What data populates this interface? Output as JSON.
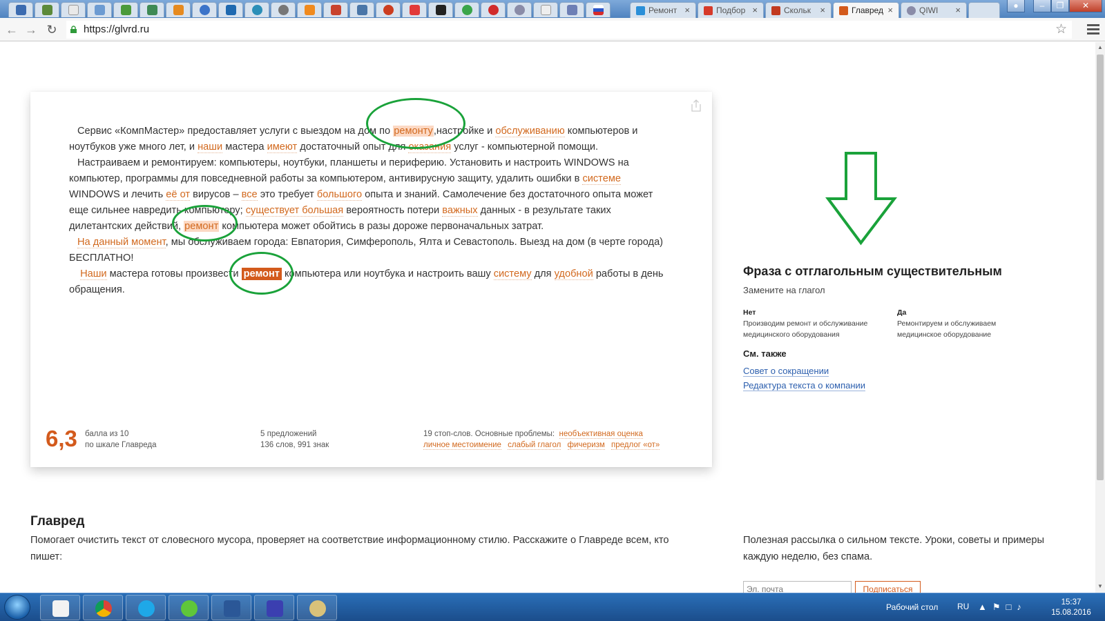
{
  "browser": {
    "tabs": [
      {
        "label": "Ремонт",
        "active": false
      },
      {
        "label": "Подбор",
        "active": false
      },
      {
        "label": "Скольк",
        "active": false
      },
      {
        "label": "Главред",
        "active": true
      },
      {
        "label": "QIWI",
        "active": false
      }
    ],
    "url": "https://glvrd.ru",
    "close_glyph": "×"
  },
  "editor": {
    "score": "6,3",
    "score_line1": "балла из 10",
    "score_line2": "по шкале Главреда",
    "stats_line1": "5 предложений",
    "stats_line2": "136 слов, 991 знак",
    "problems_label": "19 стоп-слов. Основные проблемы:",
    "problems": [
      "необъективная оценка",
      "личное местоимение",
      "слабый глагол",
      "фичеризм",
      "предлог «от»"
    ],
    "paragraphs": [
      [
        {
          "t": "Сервис «КомпМастер» предоставляет услуги с выездом на дом по "
        },
        {
          "t": "ремонту",
          "h": "bg"
        },
        {
          "t": ","
        },
        {
          "t": "настройке и "
        },
        {
          "t": "обслуживанию",
          "h": "u"
        },
        {
          "t": " компьютеров и ноутбуков уже много лет, и "
        },
        {
          "t": "наши",
          "h": "u"
        },
        {
          "t": " мастера "
        },
        {
          "t": "имеют",
          "h": "u"
        },
        {
          "t": " достаточный опыт для "
        },
        {
          "t": "оказания",
          "h": "u"
        },
        {
          "t": " услуг - компьютерной помощи."
        }
      ],
      [
        {
          "t": "Настраиваем и ремонтируем: компьютеры, ноутбуки, планшеты и периферию. Установить и настроить WINDOWS на компьютер, программы для повседневной работы за компьютером, антивирусную защиту, удалить ошибки в "
        },
        {
          "t": "системе",
          "h": "u"
        },
        {
          "t": " WINDOWS и лечить "
        },
        {
          "t": "её от",
          "h": "u"
        },
        {
          "t": " вирусов – "
        },
        {
          "t": "все",
          "h": "u"
        },
        {
          "t": " это требует "
        },
        {
          "t": "большого",
          "h": "u"
        },
        {
          "t": " опыта и знаний. Самолечение без достаточного опыта может еще сильнее навредить компьютеру; "
        },
        {
          "t": "существует большая",
          "h": "u"
        },
        {
          "t": " вероятность потери "
        },
        {
          "t": "важных",
          "h": "u"
        },
        {
          "t": " данных - в результате таких дилетантских действий, "
        },
        {
          "t": "ремонт",
          "h": "bg"
        },
        {
          "t": " компьютера может обойтись в разы дороже первоначальных затрат."
        }
      ],
      [
        {
          "t": "На данный момент",
          "h": "u"
        },
        {
          "t": ", мы обслуживаем города: Евпатория, Симферополь, Ялта и Севастополь. Выезд на дом (в черте города) БЕСПЛАТНО!"
        }
      ],
      [
        {
          "t": " "
        },
        {
          "t": "Наши",
          "h": "u"
        },
        {
          "t": " мастера готовы произвести "
        },
        {
          "t": "ремонт",
          "h": "active"
        },
        {
          "t": " компьютера или ноутбука и настроить вашу "
        },
        {
          "t": "систему",
          "h": "u"
        },
        {
          "t": " для "
        },
        {
          "t": "удобной",
          "h": "u"
        },
        {
          "t": " работы в день обращения."
        }
      ]
    ]
  },
  "sidebar": {
    "title": "Фраза с отглагольным существительным",
    "subtitle": "Замените на глагол",
    "no_label": "Нет",
    "no_example": "Производим ремонт и обслуживание медицинского оборудования",
    "yes_label": "Да",
    "yes_example": "Ремонтируем и обслуживаем медицинское оборудование",
    "see_also": "См. также",
    "links": [
      "Совет о сокращении",
      "Редактура текста о компании"
    ]
  },
  "about": {
    "title": "Главред",
    "text": "Помогает очистить текст от словесного мусора, проверяет на соответствие информационному стилю. Расскажите о Главреде всем, кто пишет:",
    "newsletter": "Полезная рассылка о сильном тексте. Уроки, советы и примеры каждую неделю, без спама.",
    "email_placeholder": "Эл. почта",
    "subscribe": "Подписаться"
  },
  "taskbar": {
    "desktop": "Рабочий стол",
    "lang": "RU",
    "time": "15:37",
    "date": "15.08.2016"
  },
  "colors": {
    "accent": "#d35a1c",
    "annotation": "#1aa23a",
    "link": "#2c5fae"
  }
}
